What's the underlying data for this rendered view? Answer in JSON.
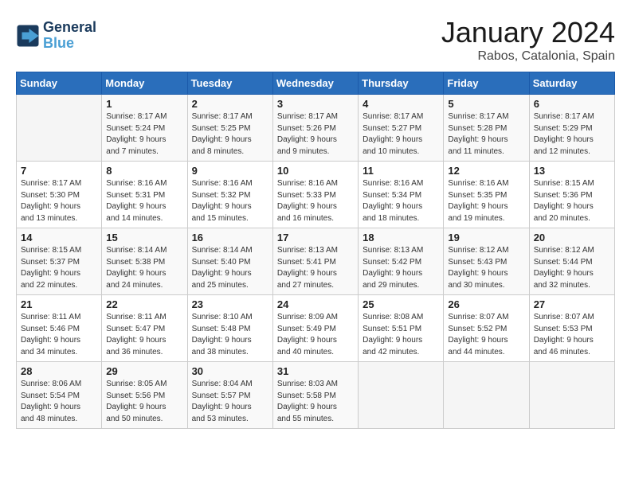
{
  "header": {
    "logo_line1": "General",
    "logo_line2": "Blue",
    "title": "January 2024",
    "subtitle": "Rabos, Catalonia, Spain"
  },
  "weekdays": [
    "Sunday",
    "Monday",
    "Tuesday",
    "Wednesday",
    "Thursday",
    "Friday",
    "Saturday"
  ],
  "weeks": [
    [
      {
        "day": "",
        "info": ""
      },
      {
        "day": "1",
        "info": "Sunrise: 8:17 AM\nSunset: 5:24 PM\nDaylight: 9 hours\nand 7 minutes."
      },
      {
        "day": "2",
        "info": "Sunrise: 8:17 AM\nSunset: 5:25 PM\nDaylight: 9 hours\nand 8 minutes."
      },
      {
        "day": "3",
        "info": "Sunrise: 8:17 AM\nSunset: 5:26 PM\nDaylight: 9 hours\nand 9 minutes."
      },
      {
        "day": "4",
        "info": "Sunrise: 8:17 AM\nSunset: 5:27 PM\nDaylight: 9 hours\nand 10 minutes."
      },
      {
        "day": "5",
        "info": "Sunrise: 8:17 AM\nSunset: 5:28 PM\nDaylight: 9 hours\nand 11 minutes."
      },
      {
        "day": "6",
        "info": "Sunrise: 8:17 AM\nSunset: 5:29 PM\nDaylight: 9 hours\nand 12 minutes."
      }
    ],
    [
      {
        "day": "7",
        "info": "Sunrise: 8:17 AM\nSunset: 5:30 PM\nDaylight: 9 hours\nand 13 minutes."
      },
      {
        "day": "8",
        "info": "Sunrise: 8:16 AM\nSunset: 5:31 PM\nDaylight: 9 hours\nand 14 minutes."
      },
      {
        "day": "9",
        "info": "Sunrise: 8:16 AM\nSunset: 5:32 PM\nDaylight: 9 hours\nand 15 minutes."
      },
      {
        "day": "10",
        "info": "Sunrise: 8:16 AM\nSunset: 5:33 PM\nDaylight: 9 hours\nand 16 minutes."
      },
      {
        "day": "11",
        "info": "Sunrise: 8:16 AM\nSunset: 5:34 PM\nDaylight: 9 hours\nand 18 minutes."
      },
      {
        "day": "12",
        "info": "Sunrise: 8:16 AM\nSunset: 5:35 PM\nDaylight: 9 hours\nand 19 minutes."
      },
      {
        "day": "13",
        "info": "Sunrise: 8:15 AM\nSunset: 5:36 PM\nDaylight: 9 hours\nand 20 minutes."
      }
    ],
    [
      {
        "day": "14",
        "info": "Sunrise: 8:15 AM\nSunset: 5:37 PM\nDaylight: 9 hours\nand 22 minutes."
      },
      {
        "day": "15",
        "info": "Sunrise: 8:14 AM\nSunset: 5:38 PM\nDaylight: 9 hours\nand 24 minutes."
      },
      {
        "day": "16",
        "info": "Sunrise: 8:14 AM\nSunset: 5:40 PM\nDaylight: 9 hours\nand 25 minutes."
      },
      {
        "day": "17",
        "info": "Sunrise: 8:13 AM\nSunset: 5:41 PM\nDaylight: 9 hours\nand 27 minutes."
      },
      {
        "day": "18",
        "info": "Sunrise: 8:13 AM\nSunset: 5:42 PM\nDaylight: 9 hours\nand 29 minutes."
      },
      {
        "day": "19",
        "info": "Sunrise: 8:12 AM\nSunset: 5:43 PM\nDaylight: 9 hours\nand 30 minutes."
      },
      {
        "day": "20",
        "info": "Sunrise: 8:12 AM\nSunset: 5:44 PM\nDaylight: 9 hours\nand 32 minutes."
      }
    ],
    [
      {
        "day": "21",
        "info": "Sunrise: 8:11 AM\nSunset: 5:46 PM\nDaylight: 9 hours\nand 34 minutes."
      },
      {
        "day": "22",
        "info": "Sunrise: 8:11 AM\nSunset: 5:47 PM\nDaylight: 9 hours\nand 36 minutes."
      },
      {
        "day": "23",
        "info": "Sunrise: 8:10 AM\nSunset: 5:48 PM\nDaylight: 9 hours\nand 38 minutes."
      },
      {
        "day": "24",
        "info": "Sunrise: 8:09 AM\nSunset: 5:49 PM\nDaylight: 9 hours\nand 40 minutes."
      },
      {
        "day": "25",
        "info": "Sunrise: 8:08 AM\nSunset: 5:51 PM\nDaylight: 9 hours\nand 42 minutes."
      },
      {
        "day": "26",
        "info": "Sunrise: 8:07 AM\nSunset: 5:52 PM\nDaylight: 9 hours\nand 44 minutes."
      },
      {
        "day": "27",
        "info": "Sunrise: 8:07 AM\nSunset: 5:53 PM\nDaylight: 9 hours\nand 46 minutes."
      }
    ],
    [
      {
        "day": "28",
        "info": "Sunrise: 8:06 AM\nSunset: 5:54 PM\nDaylight: 9 hours\nand 48 minutes."
      },
      {
        "day": "29",
        "info": "Sunrise: 8:05 AM\nSunset: 5:56 PM\nDaylight: 9 hours\nand 50 minutes."
      },
      {
        "day": "30",
        "info": "Sunrise: 8:04 AM\nSunset: 5:57 PM\nDaylight: 9 hours\nand 53 minutes."
      },
      {
        "day": "31",
        "info": "Sunrise: 8:03 AM\nSunset: 5:58 PM\nDaylight: 9 hours\nand 55 minutes."
      },
      {
        "day": "",
        "info": ""
      },
      {
        "day": "",
        "info": ""
      },
      {
        "day": "",
        "info": ""
      }
    ]
  ]
}
